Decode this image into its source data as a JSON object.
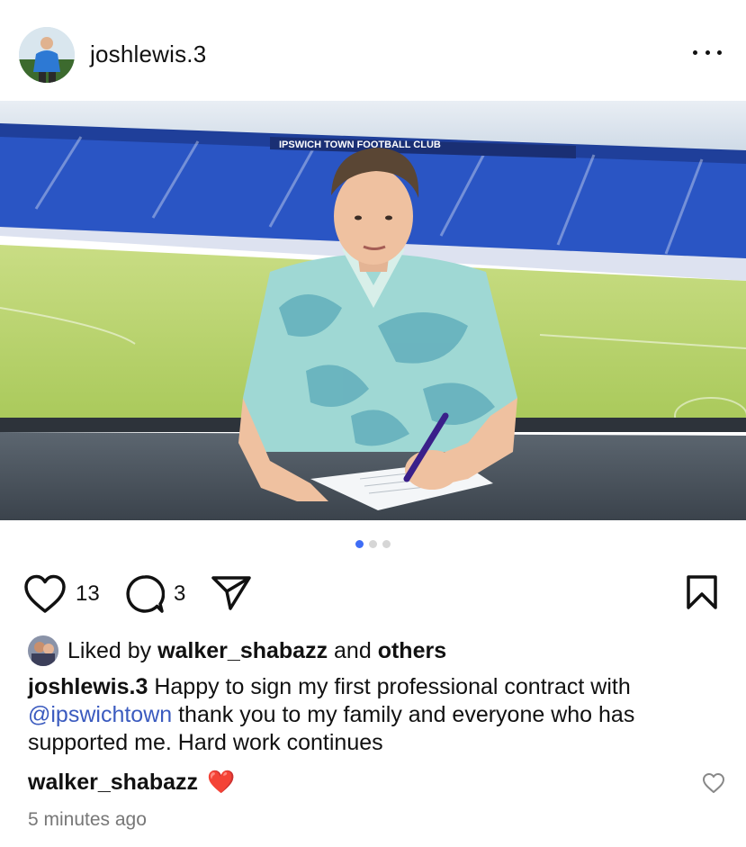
{
  "post": {
    "username": "joshlewis.3",
    "likes_count": "13",
    "comments_count": "3"
  },
  "liked_by": {
    "prefix": "Liked by",
    "user": "walker_shabazz",
    "and": "and",
    "others": "others"
  },
  "caption": {
    "user": "joshlewis.3",
    "text_part1": "Happy to sign my first professional contract with",
    "mention": "@ipswichtown",
    "text_part2": "thank you to my family and everyone who has supported me. Hard work continues"
  },
  "comment": {
    "user": "walker_shabazz",
    "emoji": "❤️"
  },
  "time_ago": "5 minutes ago",
  "carousel": {
    "count": 3,
    "active_index": 0
  },
  "photo_signage": {
    "stand": "IPSWICH TOWN FOOTBALL CLUB"
  },
  "colors": {
    "accent": "#3f6df6",
    "mention": "#3b5bbf",
    "pitch": "#b7d66a",
    "seats": "#2a4fb8"
  },
  "icons": [
    "more-options-icon",
    "heart-icon",
    "comment-icon",
    "share-icon",
    "bookmark-icon",
    "small-heart-icon"
  ]
}
